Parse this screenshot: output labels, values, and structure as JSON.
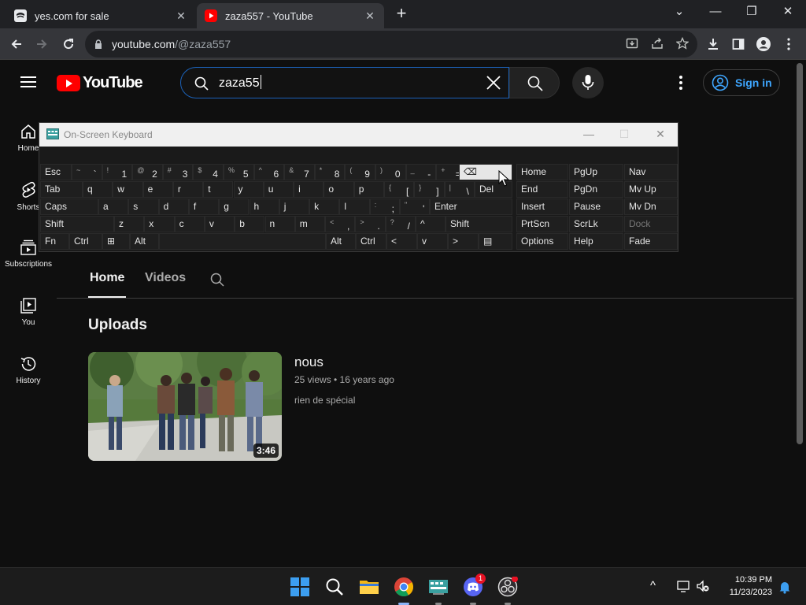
{
  "browser": {
    "tabs": [
      {
        "label": "yes.com for sale",
        "active": false
      },
      {
        "label": "zaza557 - YouTube",
        "active": true
      }
    ],
    "close_glyph": "✕",
    "new_tab_glyph": "+",
    "window_controls": {
      "dropdown": "⌄",
      "minimize": "—",
      "restore": "❐",
      "close": "✕"
    },
    "url_host": "youtube.com",
    "url_path": "/@zaza557"
  },
  "youtube": {
    "logo_text": "YouTube",
    "search_query": "zaza55",
    "signin_label": "Sign in",
    "guide": [
      {
        "label": "Home"
      },
      {
        "label": "Shorts"
      },
      {
        "label": "Subscriptions"
      },
      {
        "label": "You"
      },
      {
        "label": "History"
      }
    ],
    "channel_tabs": [
      {
        "label": "Home",
        "active": true
      },
      {
        "label": "Videos",
        "active": false
      }
    ],
    "section_title": "Uploads",
    "video": {
      "title": "nous",
      "meta": "25 views • 16 years ago",
      "description": "rien de spécial",
      "duration": "3:46"
    }
  },
  "osk": {
    "title": "On-Screen Keyboard",
    "controls": {
      "minimize": "—",
      "maximize": "☐",
      "close": "✕"
    },
    "row1": [
      {
        "main": "Esc"
      },
      {
        "shift": "~",
        "main": "`"
      },
      {
        "shift": "!",
        "main": "1"
      },
      {
        "shift": "@",
        "main": "2"
      },
      {
        "shift": "#",
        "main": "3"
      },
      {
        "shift": "$",
        "main": "4"
      },
      {
        "shift": "%",
        "main": "5"
      },
      {
        "shift": "^",
        "main": "6"
      },
      {
        "shift": "&",
        "main": "7"
      },
      {
        "shift": "*",
        "main": "8"
      },
      {
        "shift": "(",
        "main": "9"
      },
      {
        "shift": ")",
        "main": "0"
      },
      {
        "shift": "_",
        "main": "-"
      },
      {
        "shift": "+",
        "main": "="
      },
      {
        "main": "⌫"
      }
    ],
    "row2": [
      "Tab",
      "q",
      "w",
      "e",
      "r",
      "t",
      "y",
      "u",
      "i",
      "o",
      "p",
      "[",
      "]",
      "\\",
      "Del"
    ],
    "row2_shift": {
      "[": "{",
      "]": "}",
      "\\": "|"
    },
    "row3": [
      "Caps",
      "a",
      "s",
      "d",
      "f",
      "g",
      "h",
      "j",
      "k",
      "l",
      ";",
      "'",
      "Enter"
    ],
    "row3_shift": {
      ";": ":",
      "'": "\""
    },
    "row4": [
      "Shift",
      "z",
      "x",
      "c",
      "v",
      "b",
      "n",
      "m",
      ",",
      ".",
      "/",
      "^",
      "Shift"
    ],
    "row4_shift": {
      ",": "<",
      ".": ">",
      "/": "?"
    },
    "row5": [
      "Fn",
      "Ctrl",
      "⊞",
      "Alt",
      "",
      "Alt",
      "Ctrl",
      "<",
      "v",
      ">",
      "▤"
    ],
    "nav_keys": [
      [
        "Home",
        "PgUp",
        "Nav"
      ],
      [
        "End",
        "PgDn",
        "Mv Up"
      ],
      [
        "Insert",
        "Pause",
        "Mv Dn"
      ],
      [
        "PrtScn",
        "ScrLk",
        "Dock"
      ],
      [
        "Options",
        "Help",
        "Fade"
      ]
    ]
  },
  "taskbar": {
    "time": "10:39 PM",
    "date": "11/23/2023",
    "discord_badge": "1",
    "tray_chevron": "^"
  },
  "colors": {
    "yt_red": "#ff0000",
    "link_blue": "#3ea6ff",
    "search_focus": "#1c62b9",
    "bg": "#0f0f0f"
  }
}
